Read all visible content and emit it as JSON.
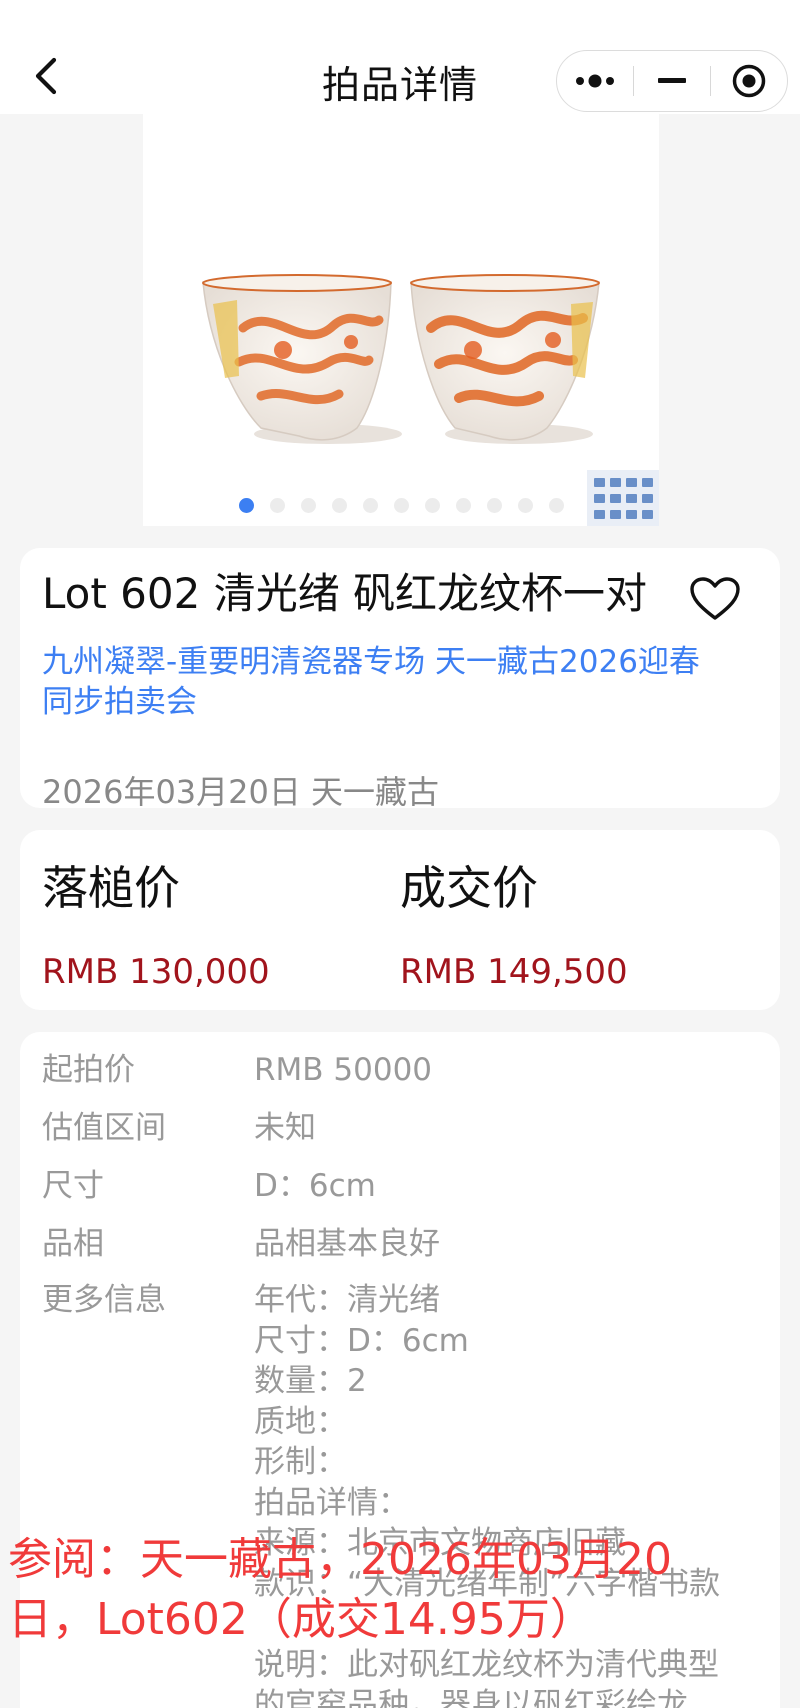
{
  "header": {
    "title": "拍品详情",
    "back_icon": "chevron-left-icon",
    "capsule": [
      "more-dots-icon",
      "minimize-icon",
      "target-close-icon"
    ]
  },
  "gallery": {
    "image": "two-iron-red-dragon-cups",
    "dot_count": 11,
    "active_index": 0,
    "mark_thumb": "reign-mark-thumbnail"
  },
  "lot": {
    "title": "Lot 602 清光绪 矾红龙纹杯一对",
    "sale_line_1": "九州凝翠-重要明清瓷器专场 天一藏古2026迎春",
    "sale_line_2": "同步拍卖会",
    "date_house": "2026年03月20日 天一藏古"
  },
  "prices": {
    "hammer_label": "落槌价",
    "hammer_value": "RMB 130,000",
    "deal_label": "成交价",
    "deal_value": "RMB 149,500"
  },
  "info": {
    "start_key": "起拍价",
    "start_val": "RMB 50000",
    "estimate_key": "估值区间",
    "estimate_val": "未知",
    "size_key": "尺寸",
    "size_val": "D：6cm",
    "condition_key": "品相",
    "condition_val": "品相基本良好",
    "more_key": "更多信息",
    "more_lines": [
      "年代：清光绪",
      "尺寸：D：6cm",
      "数量：2",
      "质地：",
      "形制：",
      "拍品详情：",
      "来源：北京市文物商店旧藏",
      "款识：“大清光绪年制”六字楷书款",
      "",
      "说明：此对矾红龙纹杯为清代典型",
      "的官窑品种，器身以矾红彩绘龙"
    ]
  },
  "watermark": {
    "line_1": "参阅：天一藏古，2026年03月20",
    "line_2": "日，Lot602（成交14.95万）"
  },
  "colors": {
    "accent_blue": "#3c7ff2",
    "price_red": "#a1141c",
    "watermark_red": "#f03a3a",
    "muted_gray": "#999999"
  }
}
